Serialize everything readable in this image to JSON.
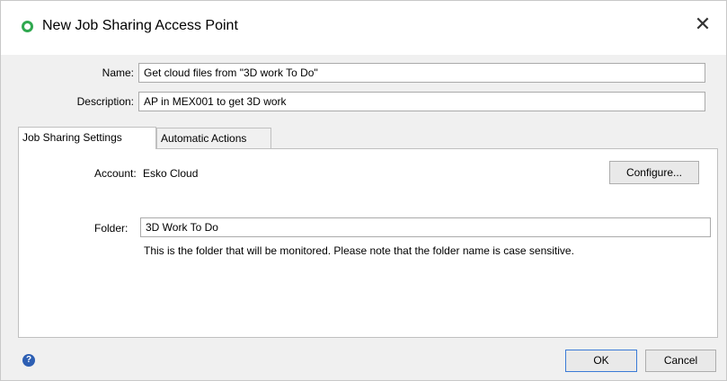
{
  "dialog": {
    "title": "New Job Sharing Access Point",
    "close_symbol": "✕",
    "title_icon": "green-circle-icon"
  },
  "form": {
    "name_label": "Name:",
    "name_value": "Get cloud files from \"3D work To Do\"",
    "description_label": "Description:",
    "description_value": "AP in MEX001 to get 3D work"
  },
  "tabs": [
    {
      "label": "Job Sharing Settings",
      "active": true
    },
    {
      "label": "Automatic Actions",
      "active": false
    }
  ],
  "settings": {
    "account_label": "Account:",
    "account_value": "Esko Cloud",
    "configure_label": "Configure...",
    "folder_label": "Folder:",
    "folder_value": "3D Work To Do",
    "folder_help": "This is the folder that will be monitored. Please note that the folder name is case sensitive."
  },
  "footer": {
    "help_symbol": "?",
    "ok_label": "OK",
    "cancel_label": "Cancel"
  },
  "colors": {
    "title_icon": "#2fa84f",
    "help_icon": "#2d5fb3",
    "default_button_border": "#3b7bd6"
  }
}
